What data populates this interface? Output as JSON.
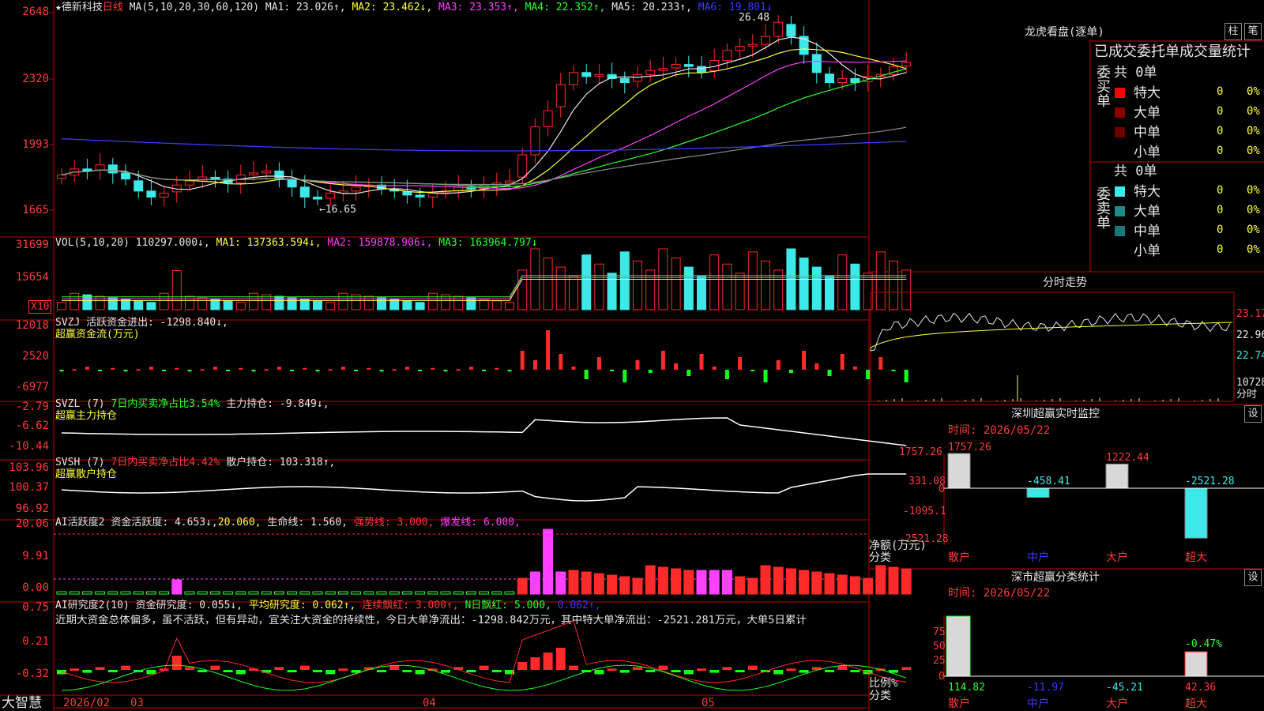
{
  "header": {
    "star": "★",
    "stock_name": "德新科技",
    "period": "日线",
    "ma_params": "MA(5,10,20,30,60,120)",
    "ma1": "MA1: 23.026↑,",
    "ma2": "MA2: 23.462↓,",
    "ma3": "MA3: 23.353↑,",
    "ma4": "MA4: 22.352↑,",
    "ma5": "MA5: 20.233↑,",
    "ma6": "MA6: 19.801↓",
    "high_label": "26.48",
    "low_label": "←16.65"
  },
  "price_axis": [
    "2648",
    "2320",
    "1993",
    "1665"
  ],
  "vol": {
    "title": "VOL(5,10,20)",
    "value": "110297.000↓,",
    "ma1": "MA1: 137363.594↓,",
    "ma2": "MA2: 159878.906↓,",
    "ma3": "MA3: 163964.797↓",
    "axis": [
      "31699",
      "15654"
    ],
    "unit": "X10"
  },
  "svzj": {
    "title": "SVZJ",
    "desc": "活跃资金进出: -1298.840↓,",
    "sub": "超赢资金流(万元)",
    "axis": [
      "12018",
      "2520",
      "-6977"
    ]
  },
  "svzl": {
    "title": "SVZL (7)",
    "ratio": "7日内买卖净占比3.54%",
    "hold": "主力持仓: -9.849↓,",
    "sub": "超赢主力持仓",
    "axis": [
      "-2.79",
      "-6.62",
      "-10.44"
    ]
  },
  "svsh": {
    "title": "SVSH (7)",
    "ratio": "7日内买卖净占比4.42%",
    "hold": "散户持仓: 103.318↑,",
    "sub": "超赢散户持仓",
    "axis": [
      "103.96",
      "100.37",
      "96.92"
    ]
  },
  "ai_active": {
    "title": "AI活跃度2",
    "a": "资金活跃度: 4.653↓,",
    "b": "20.060,",
    "c": "生命线: 1.560,",
    "d": "强势线: 3.000,",
    "e": "爆发线: 6.000,",
    "axis": [
      "20.06",
      "9.91",
      "0.00"
    ]
  },
  "ai_research": {
    "title": "AI研究度2(10)",
    "a": "资金研究度: 0.055↓,",
    "b": "平均研究度: 0.062↑,",
    "c": "连续飘红: 3.000↑,",
    "d": "N日飘红: 5.000,",
    "e": "0.062↑,",
    "commentary": "近期大资金总体偏多，虽不活跃，但有异动，宜关注大资金的持续性，今日大单净流出：-1298.842万元，其中特大单净流出：-2521.281万元，大单5日累计",
    "axis": [
      "0.75",
      "0.21",
      "-0.32"
    ]
  },
  "date_axis": {
    "brand": "大智慧",
    "labels": [
      "2026/02",
      "03",
      "04",
      "05"
    ]
  },
  "right": {
    "lhb": {
      "title": "龙虎看盘(逐单)",
      "btn1": "柱",
      "btn2": "笔",
      "header": "已成交委托单成交量统计",
      "buy": {
        "side": "委买单",
        "total": "共 0单",
        "rows": [
          {
            "label": "特大",
            "v": "0",
            "p": "0%"
          },
          {
            "label": "大单",
            "v": "0",
            "p": "0%"
          },
          {
            "label": "中单",
            "v": "0",
            "p": "0%"
          },
          {
            "label": "小单",
            "v": "0",
            "p": "0%"
          }
        ]
      },
      "sell": {
        "side": "委卖单",
        "total": "共 0单",
        "rows": [
          {
            "label": "特大",
            "v": "0",
            "p": "0%"
          },
          {
            "label": "大单",
            "v": "0",
            "p": "0%"
          },
          {
            "label": "中单",
            "v": "0",
            "p": "0%"
          },
          {
            "label": "小单",
            "v": "0",
            "p": "0%"
          }
        ]
      }
    },
    "intraday": {
      "title": "分时走势",
      "axis": [
        "23.17",
        "22.96",
        "22.74"
      ],
      "vol": "10728",
      "vol_unit": "分时"
    },
    "sz_monitor": {
      "title": "深圳超赢实时监控",
      "btn": "设",
      "time": "时间: 2026/05/22",
      "axis": [
        "1757.26",
        "331.08",
        "0",
        "-1095.1",
        "-2521.28"
      ],
      "ylabel": "净额(万元)",
      "xlabel": "分类",
      "cats": [
        "散户",
        "中户",
        "大户",
        "超大"
      ],
      "values": [
        1757.26,
        -458.41,
        1222.44,
        -2521.28
      ],
      "value_labels": [
        "1757.26",
        "-458.41",
        "1222.44",
        "-2521.28"
      ]
    },
    "sz_class": {
      "title": "深市超赢分类统计",
      "btn": "设",
      "time": "时间: 2026/05/22",
      "axis": [
        "75",
        "50",
        "25",
        "0"
      ],
      "ylabel": "比例%",
      "xlabel": "分类",
      "cats": [
        "散户",
        "中户",
        "大户",
        "超大"
      ],
      "values": [
        "114.82",
        "-11.97",
        "-45.21",
        "42.36"
      ],
      "bar_top_label": "-0.47%"
    }
  },
  "colors": {
    "up": "#ff2a2a",
    "down": "#3ee8e8",
    "grid": "#c00000",
    "ma1": "#e6e6e6",
    "ma2": "#ffff3a",
    "ma3": "#ff40ff",
    "ma4": "#2bff2b",
    "ma5": "#8a8a8a",
    "ma6": "#3a3aff"
  },
  "chart_data": {
    "type": "candlestick",
    "period": "日线",
    "high": 26.48,
    "low": 16.65,
    "price_axis": [
      26.48,
      23.2,
      19.93,
      16.65
    ],
    "close": [
      18.4,
      18.7,
      18.6,
      18.9,
      18.5,
      18.2,
      17.6,
      17.3,
      17.5,
      17.9,
      18.1,
      18.3,
      18.2,
      18.0,
      18.4,
      18.5,
      18.6,
      18.2,
      17.8,
      17.3,
      17.2,
      17.5,
      17.6,
      17.8,
      17.9,
      17.7,
      17.6,
      17.4,
      17.3,
      17.5,
      17.6,
      17.8,
      17.7,
      17.9,
      18.0,
      18.1,
      19.4,
      20.8,
      21.6,
      22.9,
      23.5,
      23.3,
      23.4,
      23.2,
      23.0,
      23.4,
      23.6,
      23.7,
      23.9,
      23.8,
      23.5,
      24.1,
      24.6,
      24.8,
      24.9,
      25.3,
      26.0,
      25.3,
      24.4,
      23.5,
      23.0,
      23.2,
      23.0,
      23.3,
      23.4,
      23.8,
      24.0
    ]
  }
}
